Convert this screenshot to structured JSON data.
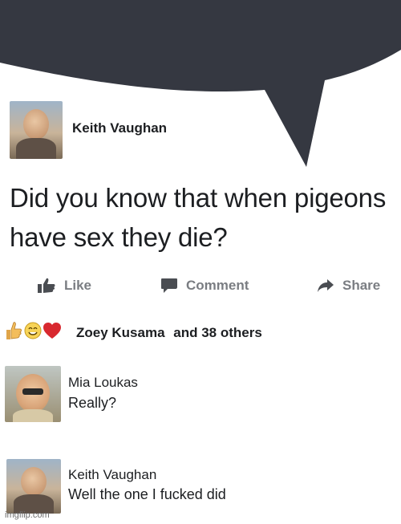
{
  "post": {
    "author": "Keith Vaughan",
    "text": "Did you know that when pigeons have sex they die?"
  },
  "actions": {
    "like": "Like",
    "comment": "Comment",
    "share": "Share"
  },
  "reactions": {
    "icons": [
      "thumbs-up-icon",
      "smiley-face-icon",
      "heart-icon"
    ],
    "names": "Zoey Kusama",
    "others": "and 38 others"
  },
  "comments": [
    {
      "author": "Mia Loukas",
      "text": "Really?"
    },
    {
      "author": "Keith Vaughan",
      "text": "Well the one I fucked did"
    }
  ],
  "watermark": "imgflip.com",
  "colors": {
    "bubble": "#353841",
    "action_text": "#7a7d82",
    "text": "#1c1e21",
    "heart": "#d8282f"
  }
}
